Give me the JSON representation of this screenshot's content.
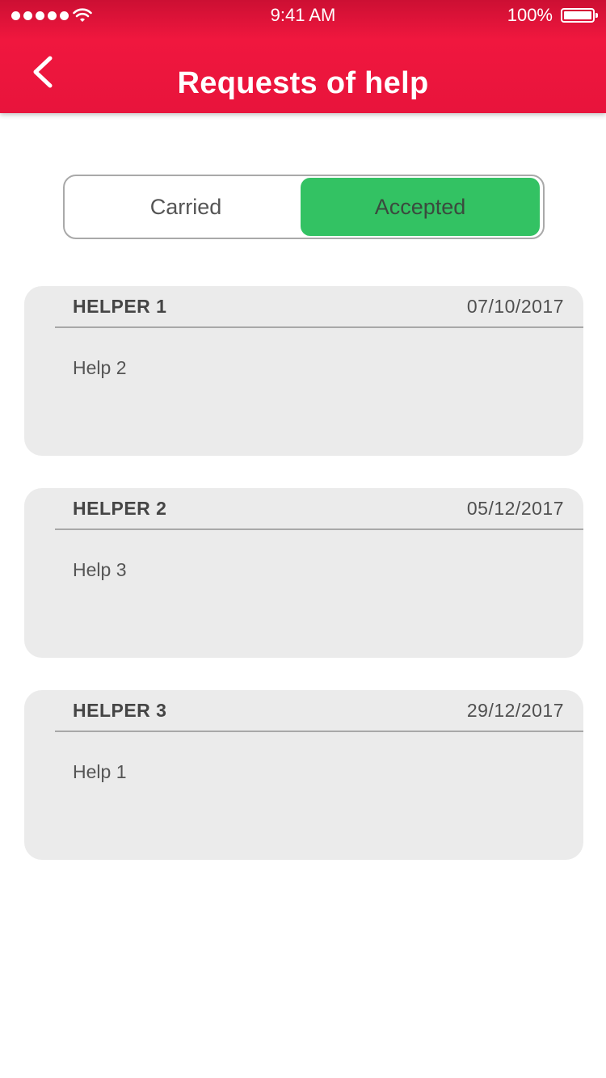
{
  "status_bar": {
    "time": "9:41 AM",
    "battery": "100%"
  },
  "header": {
    "title": "Requests of help",
    "back_icon": "chevron-left-icon"
  },
  "segments": {
    "carried_label": "Carried",
    "accepted_label": "Accepted",
    "selected": "Accepted",
    "selected_color": "#33c263"
  },
  "requests": [
    {
      "helper": "HELPER 1",
      "date": "07/10/2017",
      "description": "Help 2"
    },
    {
      "helper": "HELPER 2",
      "date": "05/12/2017",
      "description": "Help 3"
    },
    {
      "helper": "HELPER 3",
      "date": "29/12/2017",
      "description": "Help 1"
    }
  ],
  "colors": {
    "header": "#e8143c",
    "card_background": "#ebebeb"
  }
}
